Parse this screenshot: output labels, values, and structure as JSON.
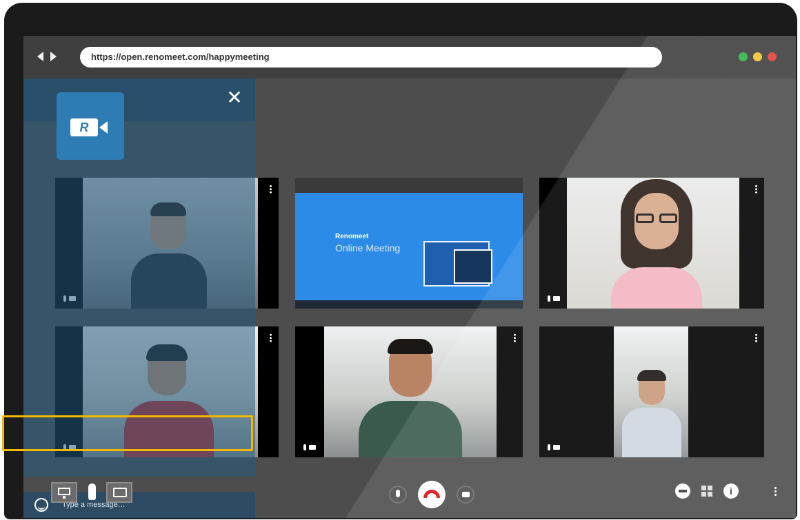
{
  "browser": {
    "url": "https://open.renomeet.com/happymeeting"
  },
  "chat": {
    "close_symbol": "✕",
    "placeholder": "Type a message…"
  },
  "logo": {
    "letter": "R"
  },
  "screen_share": {
    "headline": "Renomeet",
    "subheadline": "Online Meeting"
  },
  "toolbar": {
    "info_symbol": "i"
  },
  "colors": {
    "highlight": "#f5b800",
    "hangup": "#e3262a",
    "panel": "#265c80"
  }
}
